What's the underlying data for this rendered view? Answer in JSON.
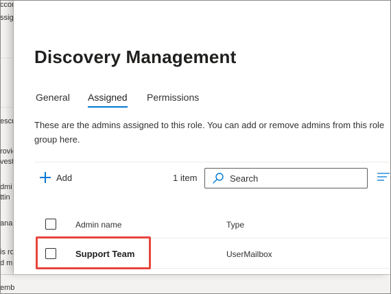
{
  "background": {
    "fragments": [
      "ccor",
      "ssig",
      "escr",
      "rovic",
      "vest",
      "dmi",
      "ttin",
      "ana",
      "is ro",
      "d m",
      "emb"
    ]
  },
  "panel": {
    "title": "Discovery Management",
    "tabs": [
      {
        "label": "General",
        "active": false
      },
      {
        "label": "Assigned",
        "active": true
      },
      {
        "label": "Permissions",
        "active": false
      }
    ],
    "description": "These are the admins assigned to this role. You can add or remove admins from this role group here.",
    "toolbar": {
      "add_label": "Add",
      "item_count": "1 item",
      "search_placeholder": "Search"
    },
    "table": {
      "columns": [
        "Admin name",
        "Type"
      ],
      "rows": [
        {
          "name": "Support Team",
          "type": "UserMailbox"
        }
      ]
    }
  },
  "colors": {
    "accent": "#0078d4",
    "highlight": "#e8453c"
  },
  "icons": [
    "plus-icon",
    "search-icon",
    "filter-icon"
  ]
}
